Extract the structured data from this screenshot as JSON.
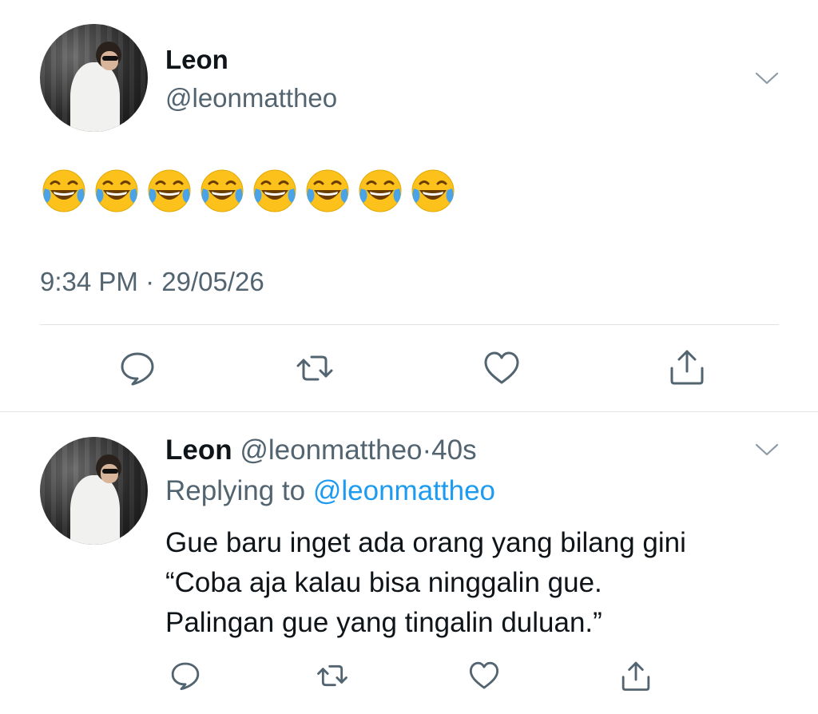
{
  "tweet": {
    "author_name": "Leon",
    "author_handle": "@leonmattheo",
    "emojis": [
      "😂",
      "😂",
      "😂",
      "😂",
      "😂",
      "😂",
      "😂",
      "😂"
    ],
    "time": "9:34 PM",
    "separator": "·",
    "date": "29/05/26",
    "actions": [
      "reply-icon",
      "retweet-icon",
      "like-icon",
      "share-icon"
    ]
  },
  "reply": {
    "author_name": "Leon",
    "author_handle": "@leonmattheo",
    "separator": "·",
    "age": "40s",
    "replying_prefix": "Replying to",
    "replying_to": "@leonmattheo",
    "lines": [
      "Gue baru inget ada orang yang bilang gini",
      "“Coba aja kalau bisa ninggalin gue.",
      "Palingan gue yang tingalin duluan.”"
    ],
    "actions": [
      "reply-icon",
      "retweet-icon",
      "like-icon",
      "share-icon"
    ]
  },
  "colors": {
    "text": "#0f1419",
    "muted": "#536471",
    "link": "#1d9bf0",
    "divider": "#e1e4e6",
    "emoji_face": "#fcc21b"
  }
}
